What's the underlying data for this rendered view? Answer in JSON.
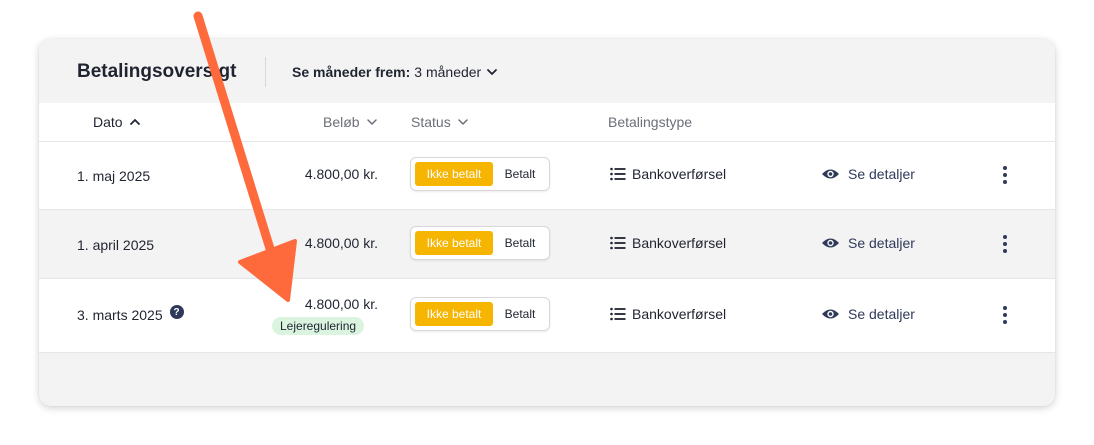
{
  "header": {
    "title": "Betalingsoversigt",
    "months_label": "Se måneder frem:",
    "months_value": "3 måneder"
  },
  "columns": {
    "dato": "Dato",
    "belob": "Beløb",
    "status": "Status",
    "type": "Betalingstype"
  },
  "rows": [
    {
      "date": "1. maj 2025",
      "amount": "4.800,00 kr.",
      "status_unpaid": "Ikke betalt",
      "status_paid": "Betalt",
      "type": "Bankoverførsel",
      "details": "Se detaljer"
    },
    {
      "date": "1. april 2025",
      "amount": "4.800,00 kr.",
      "status_unpaid": "Ikke betalt",
      "status_paid": "Betalt",
      "type": "Bankoverførsel",
      "details": "Se detaljer"
    },
    {
      "date": "3. marts 2025",
      "amount": "4.800,00 kr.",
      "badge": "Lejeregulering",
      "help_icon": "?",
      "status_unpaid": "Ikke betalt",
      "status_paid": "Betalt",
      "type": "Bankoverførsel",
      "details": "Se detaljer"
    }
  ],
  "colors": {
    "accent_unpaid": "#f6b500",
    "badge_bg": "#dbf4e0",
    "link": "#2f3a5a",
    "annotation_arrow": "#ff6a3d"
  },
  "icons": {
    "sort": "chevron-up-icon",
    "dropdown": "chevron-down-icon",
    "type": "list-icon",
    "details": "eye-icon",
    "menu": "kebab-menu-icon",
    "help": "question-circle-icon",
    "annotation": "arrow-annotation"
  }
}
